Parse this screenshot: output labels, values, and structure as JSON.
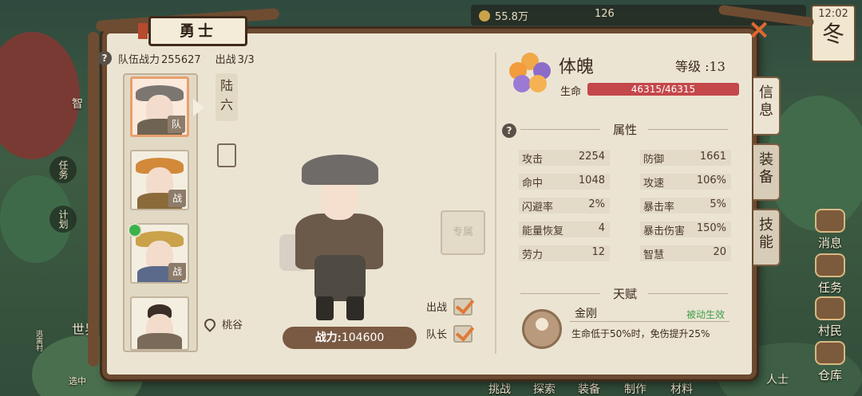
{
  "hud": {
    "resource_gold": "55.8万",
    "resource_second": "126",
    "clock_time": "12:02",
    "season": "冬"
  },
  "background_labels": {
    "left_menu": [
      "任务",
      "计划",
      "世界",
      "选中"
    ],
    "left_small": [
      "智",
      "逃离村"
    ],
    "right_menu": [
      "消息",
      "任务",
      "村民",
      "仓库"
    ],
    "bottom_text": [
      "挑战",
      "探索",
      "装备",
      "制作",
      "材料",
      "人士"
    ]
  },
  "panel": {
    "title": "勇士",
    "close_label": "×",
    "team_power_label": "队伍战力",
    "team_power_value": "255627",
    "deploy_label": "出战",
    "deploy_value": "3/3",
    "roster": [
      {
        "tag": "队",
        "selected": true
      },
      {
        "tag": "战",
        "selected": false
      },
      {
        "tag": "战",
        "selected": false
      },
      {
        "tag": "",
        "selected": false
      }
    ],
    "hero_name_vertical": "陆六",
    "exclusive_label": "专属",
    "location": "桃谷",
    "combat_power_label": "战力:",
    "combat_power_value": "104600",
    "checkbox_deploy_label": "出战",
    "checkbox_captain_label": "队长"
  },
  "spirit": {
    "name": "体魄",
    "level_label": "等级 :",
    "level_value": "13",
    "hp_label": "生命",
    "hp_text": "46315/46315",
    "hp_fraction": 1.0
  },
  "attributes": {
    "title": "属性",
    "stats": [
      {
        "k": "攻击",
        "v": "2254"
      },
      {
        "k": "防御",
        "v": "1661"
      },
      {
        "k": "命中",
        "v": "1048"
      },
      {
        "k": "攻速",
        "v": "106%"
      },
      {
        "k": "闪避率",
        "v": "2%"
      },
      {
        "k": "暴击率",
        "v": "5%"
      },
      {
        "k": "能量恢复",
        "v": "4"
      },
      {
        "k": "暴击伤害",
        "v": "150%"
      },
      {
        "k": "劳力",
        "v": "12"
      },
      {
        "k": "智慧",
        "v": "20"
      }
    ]
  },
  "talent": {
    "title": "天赋",
    "name": "金刚",
    "type": "被动生效",
    "description": "生命低于50%时，免伤提升25%"
  },
  "tabs": [
    {
      "label": "信息",
      "active": true
    },
    {
      "label": "装备",
      "active": false
    },
    {
      "label": "技能",
      "active": false
    }
  ],
  "colors": {
    "hp_fill": "#c4474a",
    "checkmark": "#e07a36",
    "close_x": "#e0672f",
    "passive_green": "#3ea04a",
    "panel_bg": "#ece4d3",
    "frame_wood": "#6b4a30"
  }
}
